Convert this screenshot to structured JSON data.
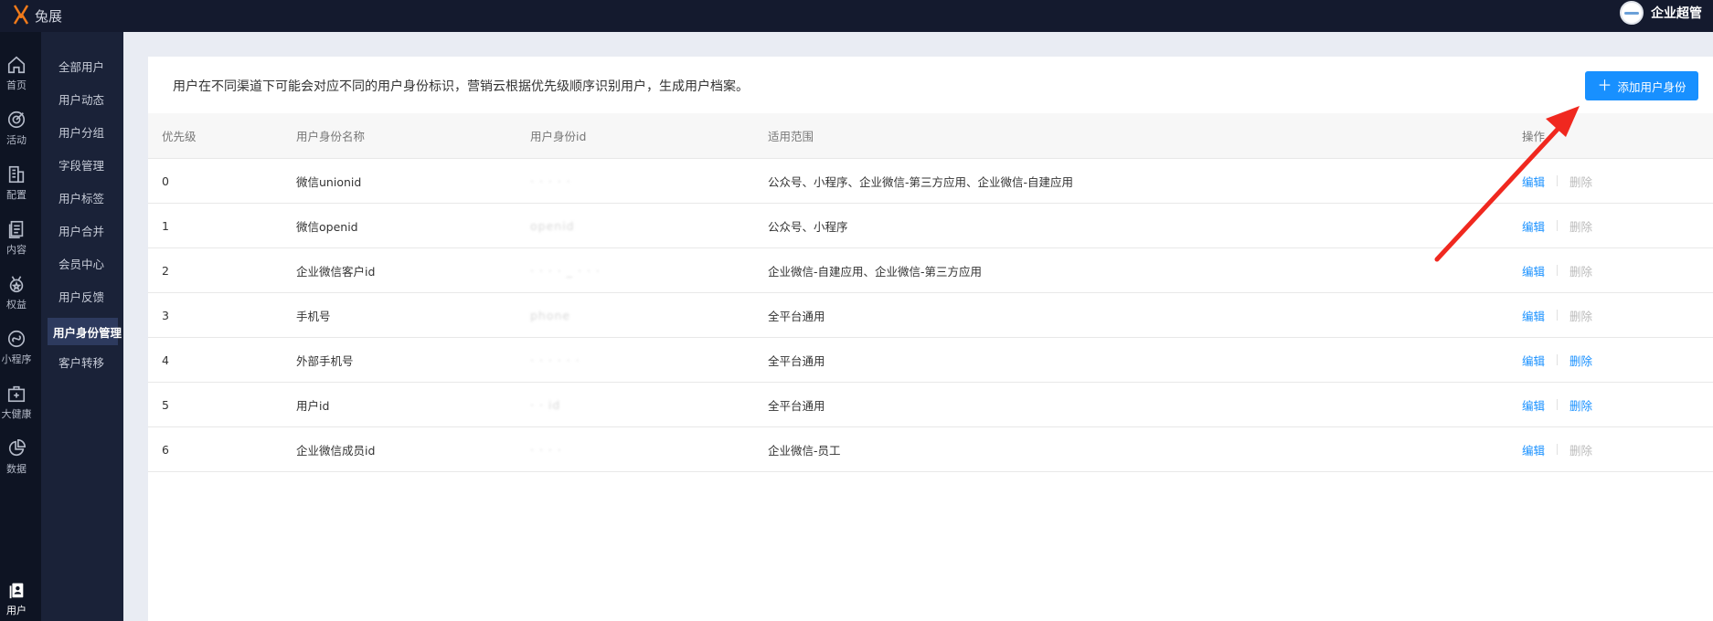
{
  "topbar": {
    "logo_text": "兔展",
    "user_name": "企业超管"
  },
  "rail": [
    {
      "name": "rail-home",
      "icon": "home-icon",
      "label": "首页",
      "active": false
    },
    {
      "name": "rail-activity",
      "icon": "target-icon",
      "label": "活动",
      "active": false
    },
    {
      "name": "rail-config",
      "icon": "building-icon",
      "label": "配置",
      "active": false
    },
    {
      "name": "rail-content",
      "icon": "document-icon",
      "label": "内容",
      "active": false
    },
    {
      "name": "rail-benefits",
      "icon": "medal-icon",
      "label": "权益",
      "active": false
    },
    {
      "name": "rail-miniprogram",
      "icon": "miniprogram-icon",
      "label": "小程序",
      "active": false
    },
    {
      "name": "rail-health",
      "icon": "medical-kit-icon",
      "label": "大健康",
      "active": false
    },
    {
      "name": "rail-data",
      "icon": "pie-chart-icon",
      "label": "数据",
      "active": false
    },
    {
      "name": "rail-user",
      "icon": "user-card-icon",
      "label": "用户",
      "active": true
    }
  ],
  "submenu": [
    {
      "label": "全部用户",
      "active": false
    },
    {
      "label": "用户动态",
      "active": false
    },
    {
      "label": "用户分组",
      "active": false
    },
    {
      "label": "字段管理",
      "active": false
    },
    {
      "label": "用户标签",
      "active": false
    },
    {
      "label": "用户合并",
      "active": false
    },
    {
      "label": "会员中心",
      "active": false
    },
    {
      "label": "用户反馈",
      "active": false
    },
    {
      "label": "用户身份管理",
      "active": true
    },
    {
      "label": "客户转移",
      "active": false
    }
  ],
  "main": {
    "notice": "用户在不同渠道下可能会对应不同的用户身份标识，营销云根据优先级顺序识别用户，生成用户档案。",
    "add_button_label": "添加用户身份"
  },
  "table": {
    "headers": [
      "优先级",
      "用户身份名称",
      "用户身份id",
      "适用范围",
      "操作"
    ],
    "edit_label": "编辑",
    "delete_label": "删除",
    "rows": [
      {
        "priority": "0",
        "name": "微信unionid",
        "id_masked": "·  ·  ·  ·  ·",
        "scope": "公众号、小程序、企业微信-第三方应用、企业微信-自建应用",
        "delete_enabled": false
      },
      {
        "priority": "1",
        "name": "微信openid",
        "id_masked": "openid",
        "scope": "公众号、小程序",
        "delete_enabled": false
      },
      {
        "priority": "2",
        "name": "企业微信客户id",
        "id_masked": "·  ·  ·  ·  _  ·  ·  ·",
        "scope": "企业微信-自建应用、企业微信-第三方应用",
        "delete_enabled": false
      },
      {
        "priority": "3",
        "name": "手机号",
        "id_masked": "phone",
        "scope": "全平台通用",
        "delete_enabled": false
      },
      {
        "priority": "4",
        "name": "外部手机号",
        "id_masked": "·  ·  ·  ·  ·  ·",
        "scope": "全平台通用",
        "delete_enabled": true
      },
      {
        "priority": "5",
        "name": "用户id",
        "id_masked": "·  ·  id",
        "scope": "全平台通用",
        "delete_enabled": true
      },
      {
        "priority": "6",
        "name": "企业微信成员id",
        "id_masked": "·  ·  ·  ·",
        "scope": "企业微信-员工",
        "delete_enabled": false
      }
    ]
  },
  "colors": {
    "topbar_bg": "#141a2e",
    "accent": "#1890ff",
    "annotation_arrow": "#f0281f"
  }
}
